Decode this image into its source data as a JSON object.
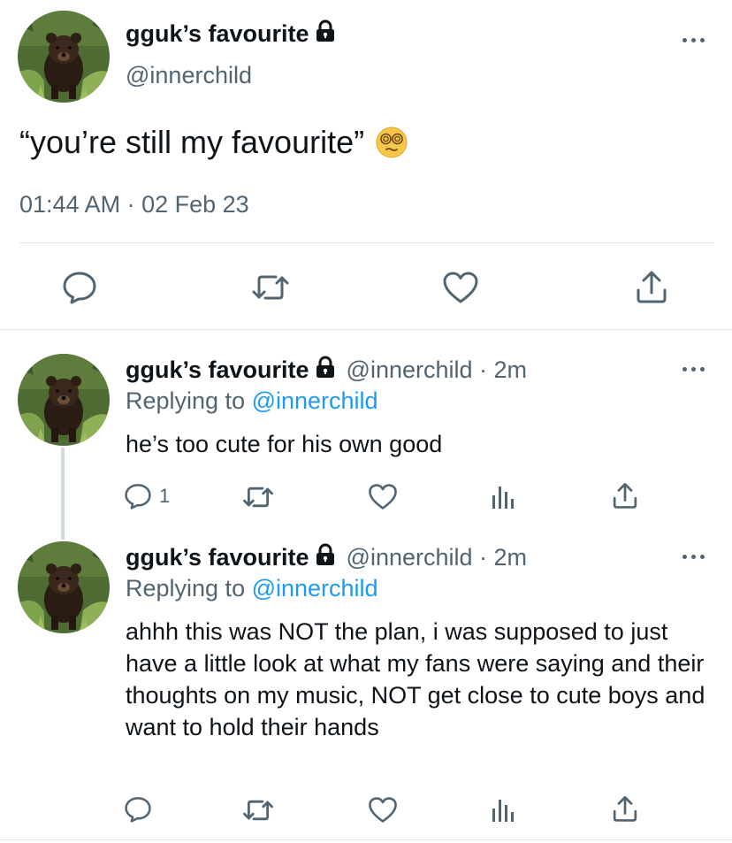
{
  "main_tweet": {
    "display_name": "gguk’s favourite",
    "handle": "@innerchild",
    "text": "“you’re still my favourite”",
    "emoji": "dizzy-face-emoji",
    "timestamp": "01:44 AM · 02 Feb 23"
  },
  "replies": [
    {
      "display_name": "gguk’s favourite",
      "handle_time": "@innerchild · 2m",
      "replying_prefix": "Replying to ",
      "replying_to": "@innerchild",
      "text": "he’s too cute for his own good",
      "reply_count": "1"
    },
    {
      "display_name": "gguk’s favourite",
      "handle_time": "@innerchild · 2m",
      "replying_prefix": "Replying to ",
      "replying_to": "@innerchild",
      "text": "ahhh this was NOT the plan, i was supposed to just have a little look at what my fans were saying and their thoughts on my music, NOT get close to cute boys and want to hold their hands",
      "reply_count": ""
    }
  ],
  "icons": {
    "lock": "lock-icon",
    "more": "more-icon",
    "reply": "reply-icon",
    "retweet": "retweet-icon",
    "like": "like-icon",
    "views": "views-icon",
    "share": "share-icon"
  },
  "colors": {
    "text": "#0f1419",
    "secondary": "#536471",
    "link": "#1d9bf0",
    "divider": "#e3e6ea",
    "thread": "#cfd9de"
  }
}
